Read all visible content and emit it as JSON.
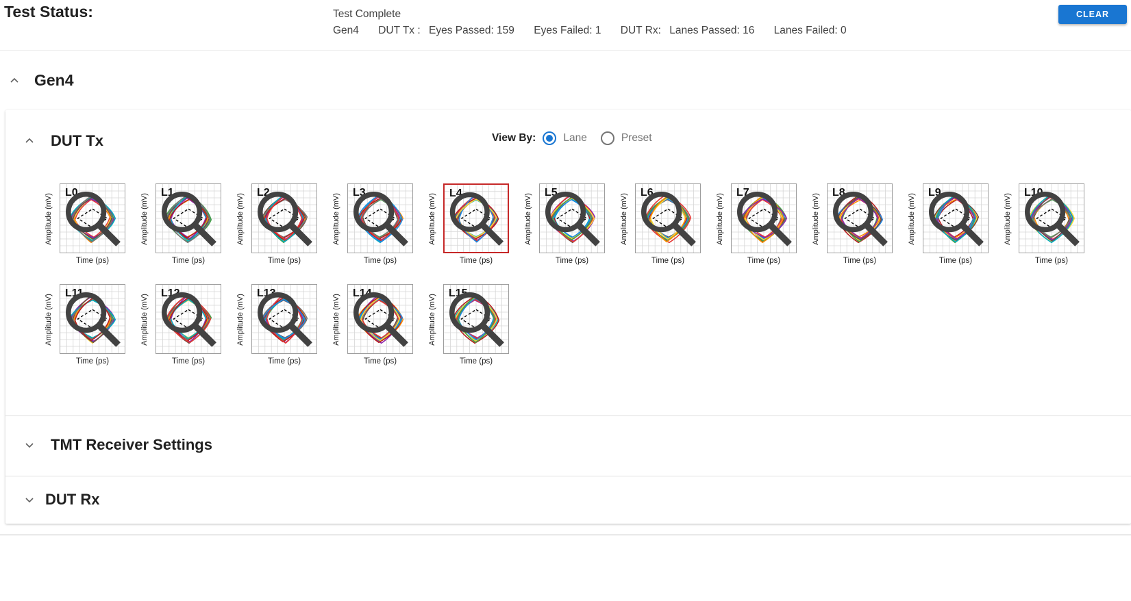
{
  "status": {
    "title": "Test Status:",
    "line1": "Test Complete",
    "gen": "Gen4",
    "tx_label": "DUT Tx :",
    "eyes_passed": "Eyes Passed: 159",
    "eyes_failed": "Eyes Failed: 1",
    "rx_label": "DUT Rx:",
    "lanes_passed": "Lanes Passed: 16",
    "lanes_failed": "Lanes Failed: 0"
  },
  "toolbar": {
    "clear_label": "CLEAR"
  },
  "gen4": {
    "title": "Gen4"
  },
  "dut_tx": {
    "title": "DUT Tx",
    "view_by_label": "View By:",
    "view_options": [
      {
        "label": "Lane",
        "checked": true
      },
      {
        "label": "Preset",
        "checked": false
      }
    ],
    "x_axis_label": "Time (ps)",
    "y_axis_label": "Amplitude (mV)",
    "lanes": [
      {
        "label": "L0"
      },
      {
        "label": "L1"
      },
      {
        "label": "L2"
      },
      {
        "label": "L3"
      },
      {
        "label": "L4",
        "selected": true
      },
      {
        "label": "L5"
      },
      {
        "label": "L6"
      },
      {
        "label": "L7"
      },
      {
        "label": "L8"
      },
      {
        "label": "L9"
      },
      {
        "label": "L10"
      },
      {
        "label": "L11"
      },
      {
        "label": "L12"
      },
      {
        "label": "L13"
      },
      {
        "label": "L14"
      },
      {
        "label": "L15"
      }
    ],
    "trace_colors": [
      "#e53935",
      "#1e88e5",
      "#fdd835",
      "#43a047",
      "#fb8c00",
      "#8e24aa",
      "#6d4c41",
      "#00acc1",
      "#757575",
      "#b71c1c"
    ]
  },
  "tmt": {
    "title": "TMT Receiver Settings"
  },
  "dut_rx": {
    "title": "DUT Rx"
  }
}
